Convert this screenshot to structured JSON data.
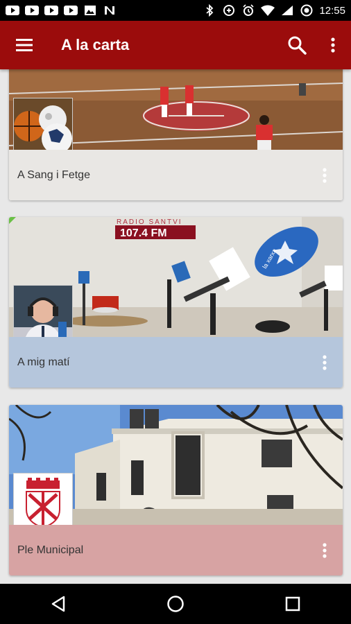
{
  "status_bar": {
    "time": "12:55",
    "left_icons": [
      "youtube-icon",
      "youtube-icon",
      "youtube-icon",
      "youtube-icon",
      "image-icon",
      "n-app-icon"
    ],
    "right_icons": [
      "bluetooth-icon",
      "data-saver-icon",
      "alarm-icon",
      "wifi-icon",
      "signal-icon",
      "do-not-disturb-icon"
    ]
  },
  "app_bar": {
    "title": "A la carta",
    "color": "#9b0c0c",
    "menu_icon": "menu-icon",
    "search_icon": "search-icon",
    "overflow_icon": "more-vert-icon"
  },
  "cards": [
    {
      "label": "A Sang i Fetge",
      "footer_color": "#e9e7e4",
      "image": "futsal-court-photo",
      "thumb": "sports-balls-photo"
    },
    {
      "label": "A mig matí",
      "footer_color": "#b5c6dc",
      "image": "radio-studio-microphones-photo",
      "thumb": "presenter-headphones-photo",
      "studio_sign": "RADIO SANTVI",
      "frequency": "107.4 FM",
      "mic_brand": "la xarxa"
    },
    {
      "label": "Ple Municipal",
      "footer_color": "#d7a3a3",
      "image": "town-hall-building-photo",
      "thumb": "municipal-coat-of-arms"
    }
  ],
  "nav_bar": {
    "back_icon": "back-icon",
    "home_icon": "home-icon",
    "recents_icon": "recents-icon"
  }
}
